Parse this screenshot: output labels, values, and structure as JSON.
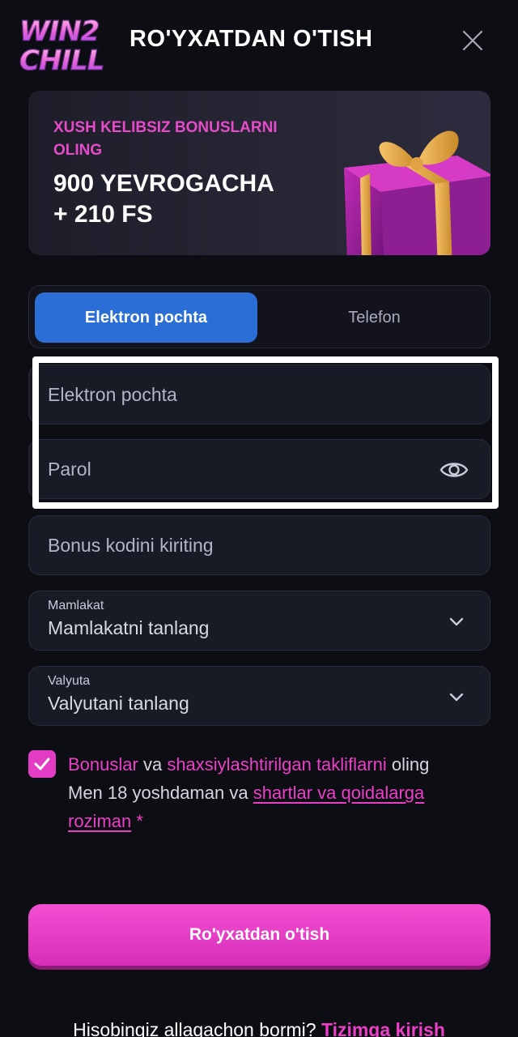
{
  "header": {
    "logo_line1": "WIN2",
    "logo_line2": "CHILL",
    "title": "RO'YXATDAN O'TISH"
  },
  "banner": {
    "subtitle": "XUSH KELIBSIZ BONUSLARNI OLING",
    "main_line1": "900 YEVROGACHA",
    "main_line2": "+ 210 FS"
  },
  "tabs": {
    "email": "Elektron pochta",
    "phone": "Telefon"
  },
  "form": {
    "email_placeholder": "Elektron pochta",
    "password_placeholder": "Parol",
    "bonus_placeholder": "Bonus kodini kiriting",
    "country_label": "Mamlakat",
    "country_value": "Mamlakatni tanlang",
    "currency_label": "Valyuta",
    "currency_value": "Valyutani tanlang"
  },
  "consent": {
    "checked": true,
    "bonuses_link": "Bonuslar",
    "and": " va ",
    "offers_link": "shaxsiylashtirilgan takliflarni",
    "get": " oling",
    "age_text": "Men 18 yoshdaman va ",
    "terms_link": "shartlar va qoidalarga roziman",
    "required_mark": " *"
  },
  "register_button": "Ro'yxatdan o'tish",
  "footer": {
    "question": "Hisobingiz allaqachon bormi? ",
    "login_link": "Tizimga kirish"
  },
  "colors": {
    "accent_pink": "#ec3fc7",
    "tab_blue": "#2b6fd6",
    "background": "#0d0d14"
  },
  "icons": [
    "close-icon",
    "gift-image",
    "eye-icon",
    "chevron-down-icon",
    "check-icon"
  ]
}
